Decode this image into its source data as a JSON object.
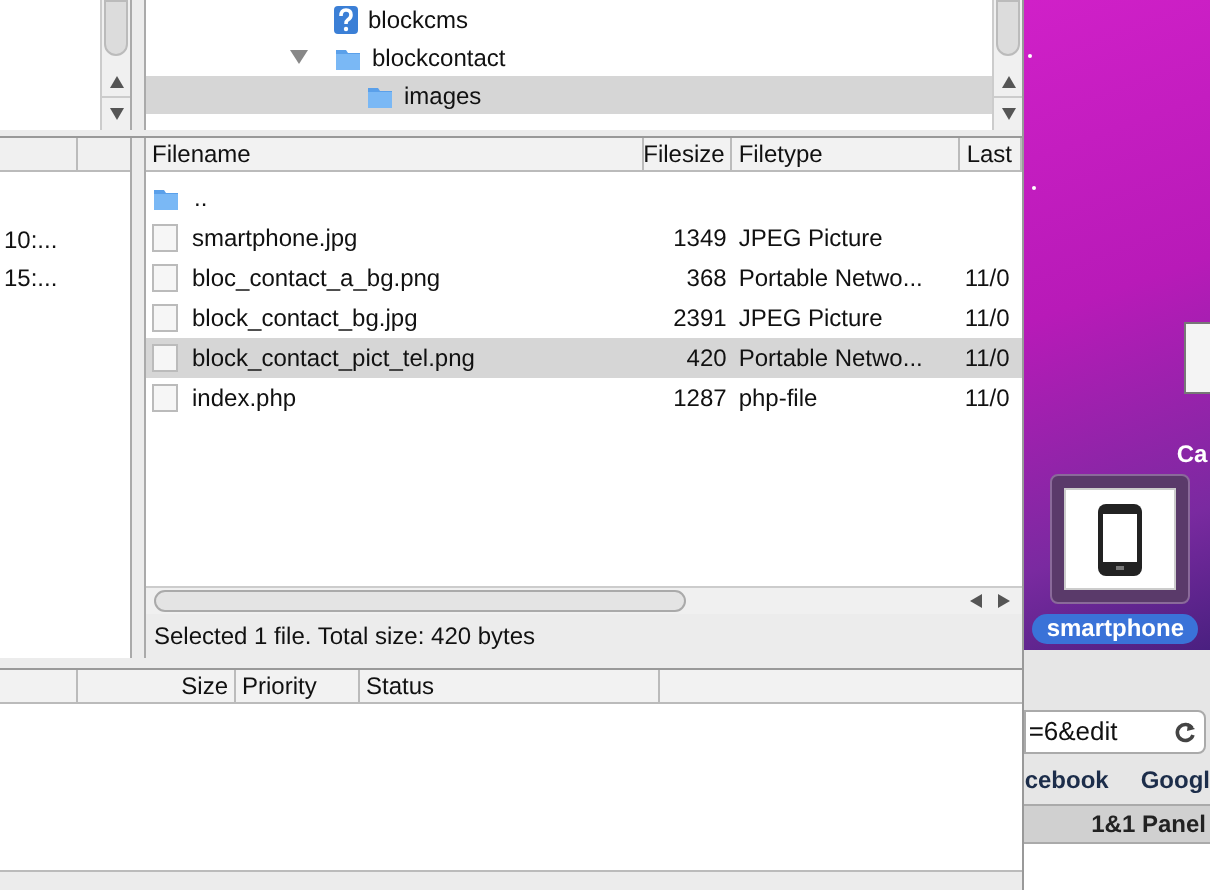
{
  "remote_tree": {
    "items": [
      {
        "name": "blockcms",
        "kind": "unknown",
        "selected": false
      },
      {
        "name": "blockcontact",
        "kind": "folder",
        "selected": false,
        "expanded": true,
        "children": [
          {
            "name": "images",
            "kind": "folder",
            "selected": true
          }
        ]
      }
    ]
  },
  "local_list": {
    "rows": [
      "10:...",
      "15:..."
    ]
  },
  "remote_list": {
    "columns": [
      "Filename",
      "Filesize",
      "Filetype",
      "Last"
    ],
    "rows": [
      {
        "name": "..",
        "kind": "folder",
        "size": "",
        "type": "",
        "modified": "",
        "selected": false
      },
      {
        "name": "smartphone.jpg",
        "kind": "file",
        "size": "1349",
        "type": "JPEG Picture",
        "modified": "",
        "selected": false
      },
      {
        "name": "bloc_contact_a_bg.png",
        "kind": "file",
        "size": "368",
        "type": "Portable Netwo...",
        "modified": "11/0",
        "selected": false
      },
      {
        "name": "block_contact_bg.jpg",
        "kind": "file",
        "size": "2391",
        "type": "JPEG Picture",
        "modified": "11/0",
        "selected": false
      },
      {
        "name": "block_contact_pict_tel.png",
        "kind": "file",
        "size": "420",
        "type": "Portable Netwo...",
        "modified": "11/0",
        "selected": true
      },
      {
        "name": "index.php",
        "kind": "file",
        "size": "1287",
        "type": "php-file",
        "modified": "11/0",
        "selected": false
      }
    ],
    "status": "Selected 1 file. Total size: 420 bytes"
  },
  "queue": {
    "columns": [
      "Size",
      "Priority",
      "Status"
    ]
  },
  "desktop": {
    "partial_label": "Ca",
    "icon_label": "smartphone"
  },
  "browser": {
    "url": "=6&edit",
    "bookmarks": [
      "cebook",
      "Googl"
    ],
    "tab": "1&1 Panel"
  }
}
